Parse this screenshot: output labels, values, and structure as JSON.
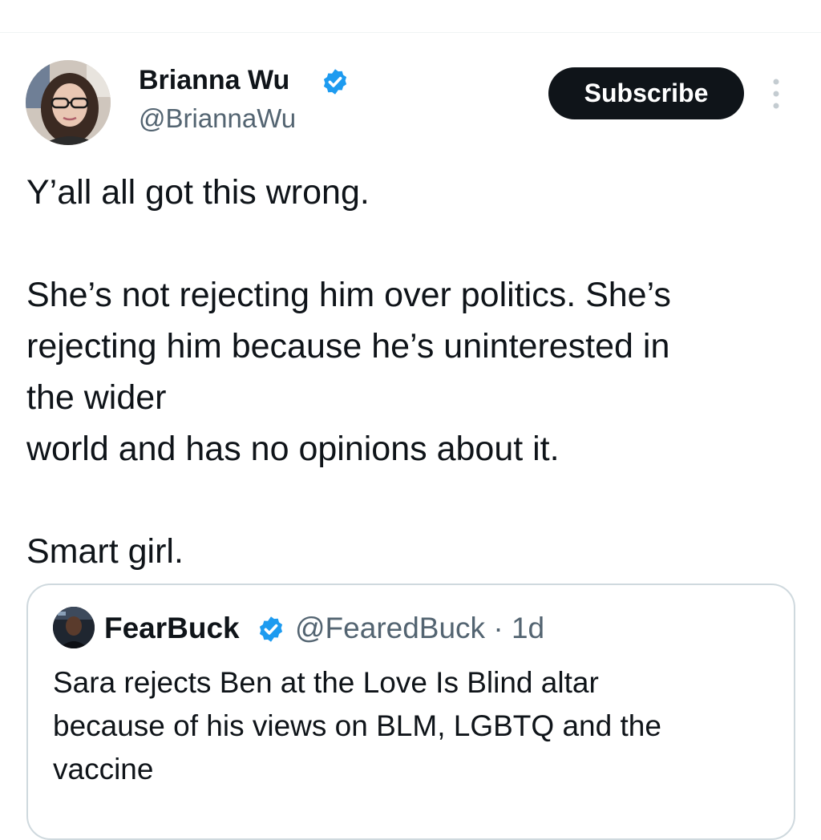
{
  "author": {
    "display_name": "Brianna Wu",
    "handle": "@BriannaWu",
    "verified": true,
    "avatar_icon": "profile-photo"
  },
  "actions": {
    "subscribe_label": "Subscribe",
    "more_icon": "more-vertical-icon"
  },
  "tweet": {
    "text": "Y’all all got this wrong.\n\nShe’s not rejecting him over politics. She’s\nrejecting him because he’s uninterested in\nthe wider\nworld and has no opinions about it.\n\nSmart girl."
  },
  "quoted_tweet": {
    "display_name": "FearBuck",
    "handle": "@FearedBuck",
    "separator": "·",
    "time": "1d",
    "verified": true,
    "text": "Sara rejects Ben at the Love Is Blind altar\nbecause of his views on BLM, LGBTQ and the\nvaccine"
  },
  "colors": {
    "verified_blue": "#1d9bf0",
    "text_primary": "#0f1419",
    "text_secondary": "#536471",
    "border": "#cfd9de",
    "button_bg": "#0f1419"
  }
}
